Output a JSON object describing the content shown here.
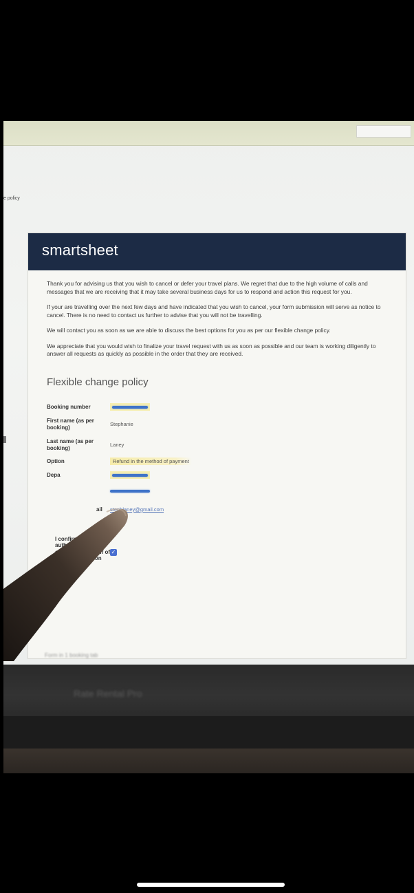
{
  "breadcrumb": "e policy",
  "brand": {
    "logo": "smartsheet",
    "header_color": "#1c2b45"
  },
  "intro": [
    "Thank you for advising us that you wish to cancel or defer your travel plans. We regret that due to the high volume of calls and messages that we are receiving that it may take several business days for us to respond and action this request for you.",
    "If your are travelling over the next few days and have indicated that you wish to cancel, your form submission will serve as notice to cancel. There is no need to contact us further to advise that you will not be travelling.",
    "We will contact you as soon as we are able to discuss the best options for you as per our flexible change policy.",
    "We appreciate that you would wish to finalize your travel request with us as soon as possible and our team is working diligently to answer all requests as quickly as possible in the order that they are received."
  ],
  "section_title": "Flexible change policy",
  "fields": {
    "booking_number_label": "Booking number",
    "first_name_label": "First name (as per booking)",
    "first_name_value": "Stephanie",
    "last_name_label": "Last name (as per booking)",
    "last_name_value": "Laney",
    "option_label": "Option",
    "option_value": "Refund in the method of payment",
    "departure_label": "Depa",
    "email_label": "ail",
    "email_value": "stephlaney@gmail.com",
    "confirm_label": "I confirm that I am authorised to make changes on behalf of all passengers on the booking",
    "confirm_checked": true
  },
  "below_screen": {
    "small_text": "Form in 1 booking tab",
    "large_text": "Rate Rental Pro"
  },
  "colors": {
    "redaction": "#3f73c8",
    "highlight": "#f6eeb0",
    "checkbox": "#4a6fd0"
  }
}
